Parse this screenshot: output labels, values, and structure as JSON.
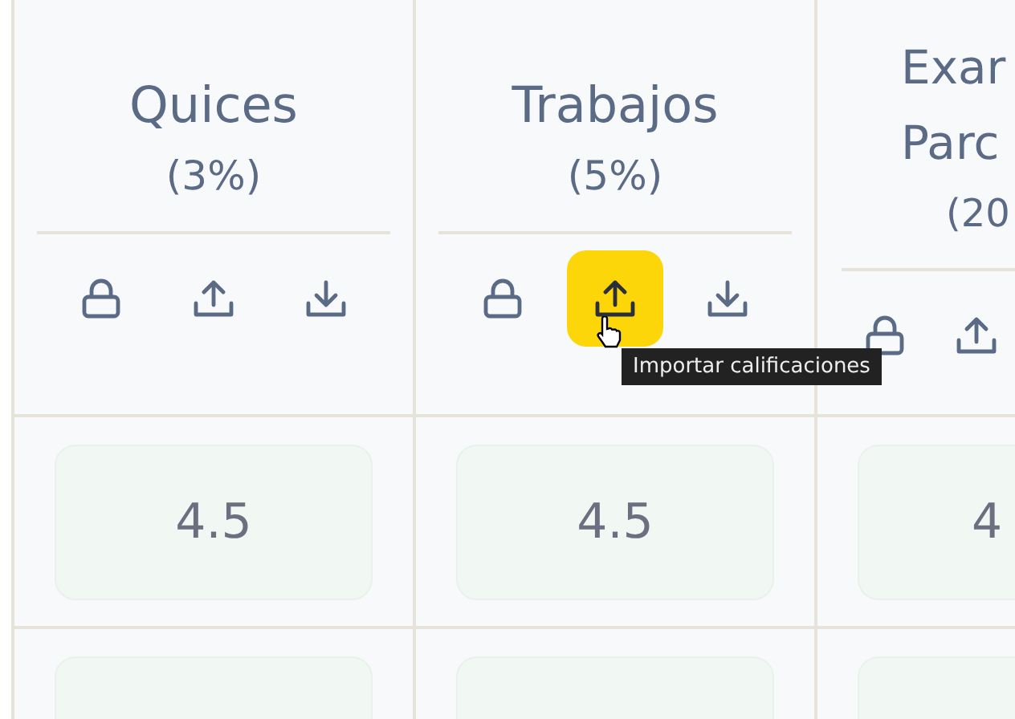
{
  "columns": [
    {
      "title_lines": [
        "Quices"
      ],
      "weight": "(3%)",
      "actions": [
        {
          "kind": "lock",
          "hovered": false
        },
        {
          "kind": "upload",
          "hovered": false
        },
        {
          "kind": "download",
          "hovered": false
        }
      ]
    },
    {
      "title_lines": [
        "Trabajos"
      ],
      "weight": "(5%)",
      "actions": [
        {
          "kind": "lock",
          "hovered": false
        },
        {
          "kind": "upload",
          "hovered": true
        },
        {
          "kind": "download",
          "hovered": false
        }
      ]
    },
    {
      "title_lines": [
        "Exar",
        "Parc"
      ],
      "weight": "(20",
      "actions": [
        {
          "kind": "lock",
          "hovered": false
        },
        {
          "kind": "upload",
          "hovered": false
        }
      ]
    }
  ],
  "tooltip": {
    "text": "Importar calificaciones"
  },
  "rows": [
    {
      "cells": [
        {
          "value": "4.5"
        },
        {
          "value": "4.5"
        },
        {
          "value": "4"
        }
      ]
    },
    {
      "cells": [
        {},
        {},
        {}
      ]
    }
  ]
}
